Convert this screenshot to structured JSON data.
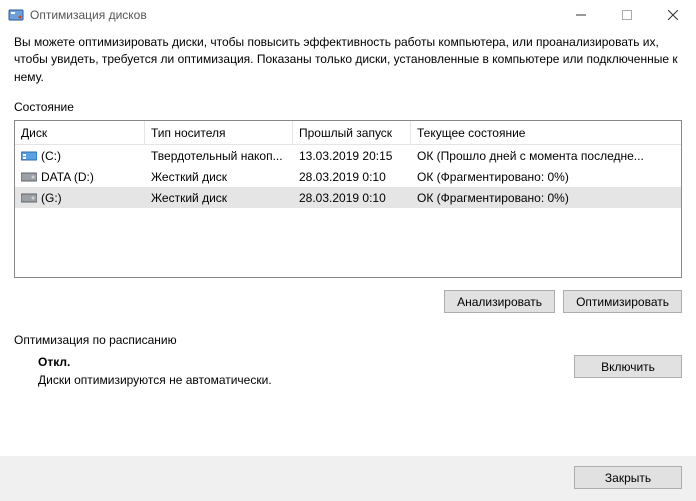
{
  "window": {
    "title": "Оптимизация дисков"
  },
  "description": "Вы можете оптимизировать диски, чтобы повысить эффективность работы  компьютера, или проанализировать их, чтобы увидеть, требуется ли оптимизация. Показаны только диски, установленные в компьютере или подключенные к нему.",
  "status_label": "Состояние",
  "columns": {
    "drive": "Диск",
    "media": "Тип носителя",
    "last_run": "Прошлый запуск",
    "current": "Текущее состояние"
  },
  "drives": [
    {
      "name": "(C:)",
      "media": "Твердотельный накоп...",
      "last_run": "13.03.2019 20:15",
      "status": "ОК (Прошло дней с момента последне...",
      "icon": "ssd"
    },
    {
      "name": "DATA (D:)",
      "media": "Жесткий диск",
      "last_run": "28.03.2019 0:10",
      "status": "ОК (Фрагментировано: 0%)",
      "icon": "hdd"
    },
    {
      "name": "(G:)",
      "media": "Жесткий диск",
      "last_run": "28.03.2019 0:10",
      "status": "ОК (Фрагментировано: 0%)",
      "icon": "hdd"
    }
  ],
  "buttons": {
    "analyze": "Анализировать",
    "optimize": "Оптимизировать",
    "enable": "Включить",
    "close": "Закрыть"
  },
  "schedule": {
    "label": "Оптимизация по расписанию",
    "status": "Откл.",
    "subtext": "Диски оптимизируются не автоматически."
  }
}
